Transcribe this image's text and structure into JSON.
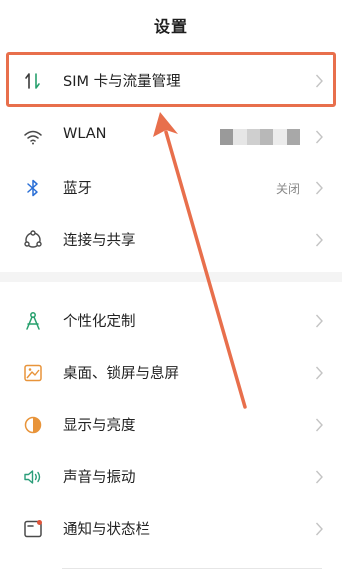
{
  "header": {
    "title": "设置"
  },
  "annotation": {
    "highlight_color": "#e86f4c"
  },
  "group1": [
    {
      "key": "sim",
      "label": "SIM 卡与流量管理",
      "icon": "sim-data-icon"
    },
    {
      "key": "wlan",
      "label": "WLAN",
      "icon": "wifi-icon",
      "value": "(blurred network name)"
    },
    {
      "key": "bluetooth",
      "label": "蓝牙",
      "icon": "bluetooth-icon",
      "value": "关闭"
    },
    {
      "key": "connect",
      "label": "连接与共享",
      "icon": "share-network-icon"
    }
  ],
  "group2": [
    {
      "key": "personalize",
      "label": "个性化定制",
      "icon": "personalize-icon"
    },
    {
      "key": "wallpaper",
      "label": "桌面、锁屏与息屏",
      "icon": "wallpaper-icon"
    },
    {
      "key": "display",
      "label": "显示与亮度",
      "icon": "display-brightness-icon"
    },
    {
      "key": "sound",
      "label": "声音与振动",
      "icon": "sound-vibration-icon"
    },
    {
      "key": "notification",
      "label": "通知与状态栏",
      "icon": "notification-icon"
    }
  ],
  "colors": {
    "icon_gray": "#555555",
    "icon_green": "#27a06d",
    "icon_orange": "#e8943a",
    "icon_teal": "#2a9d79",
    "chevron": "#c4c4c4"
  }
}
